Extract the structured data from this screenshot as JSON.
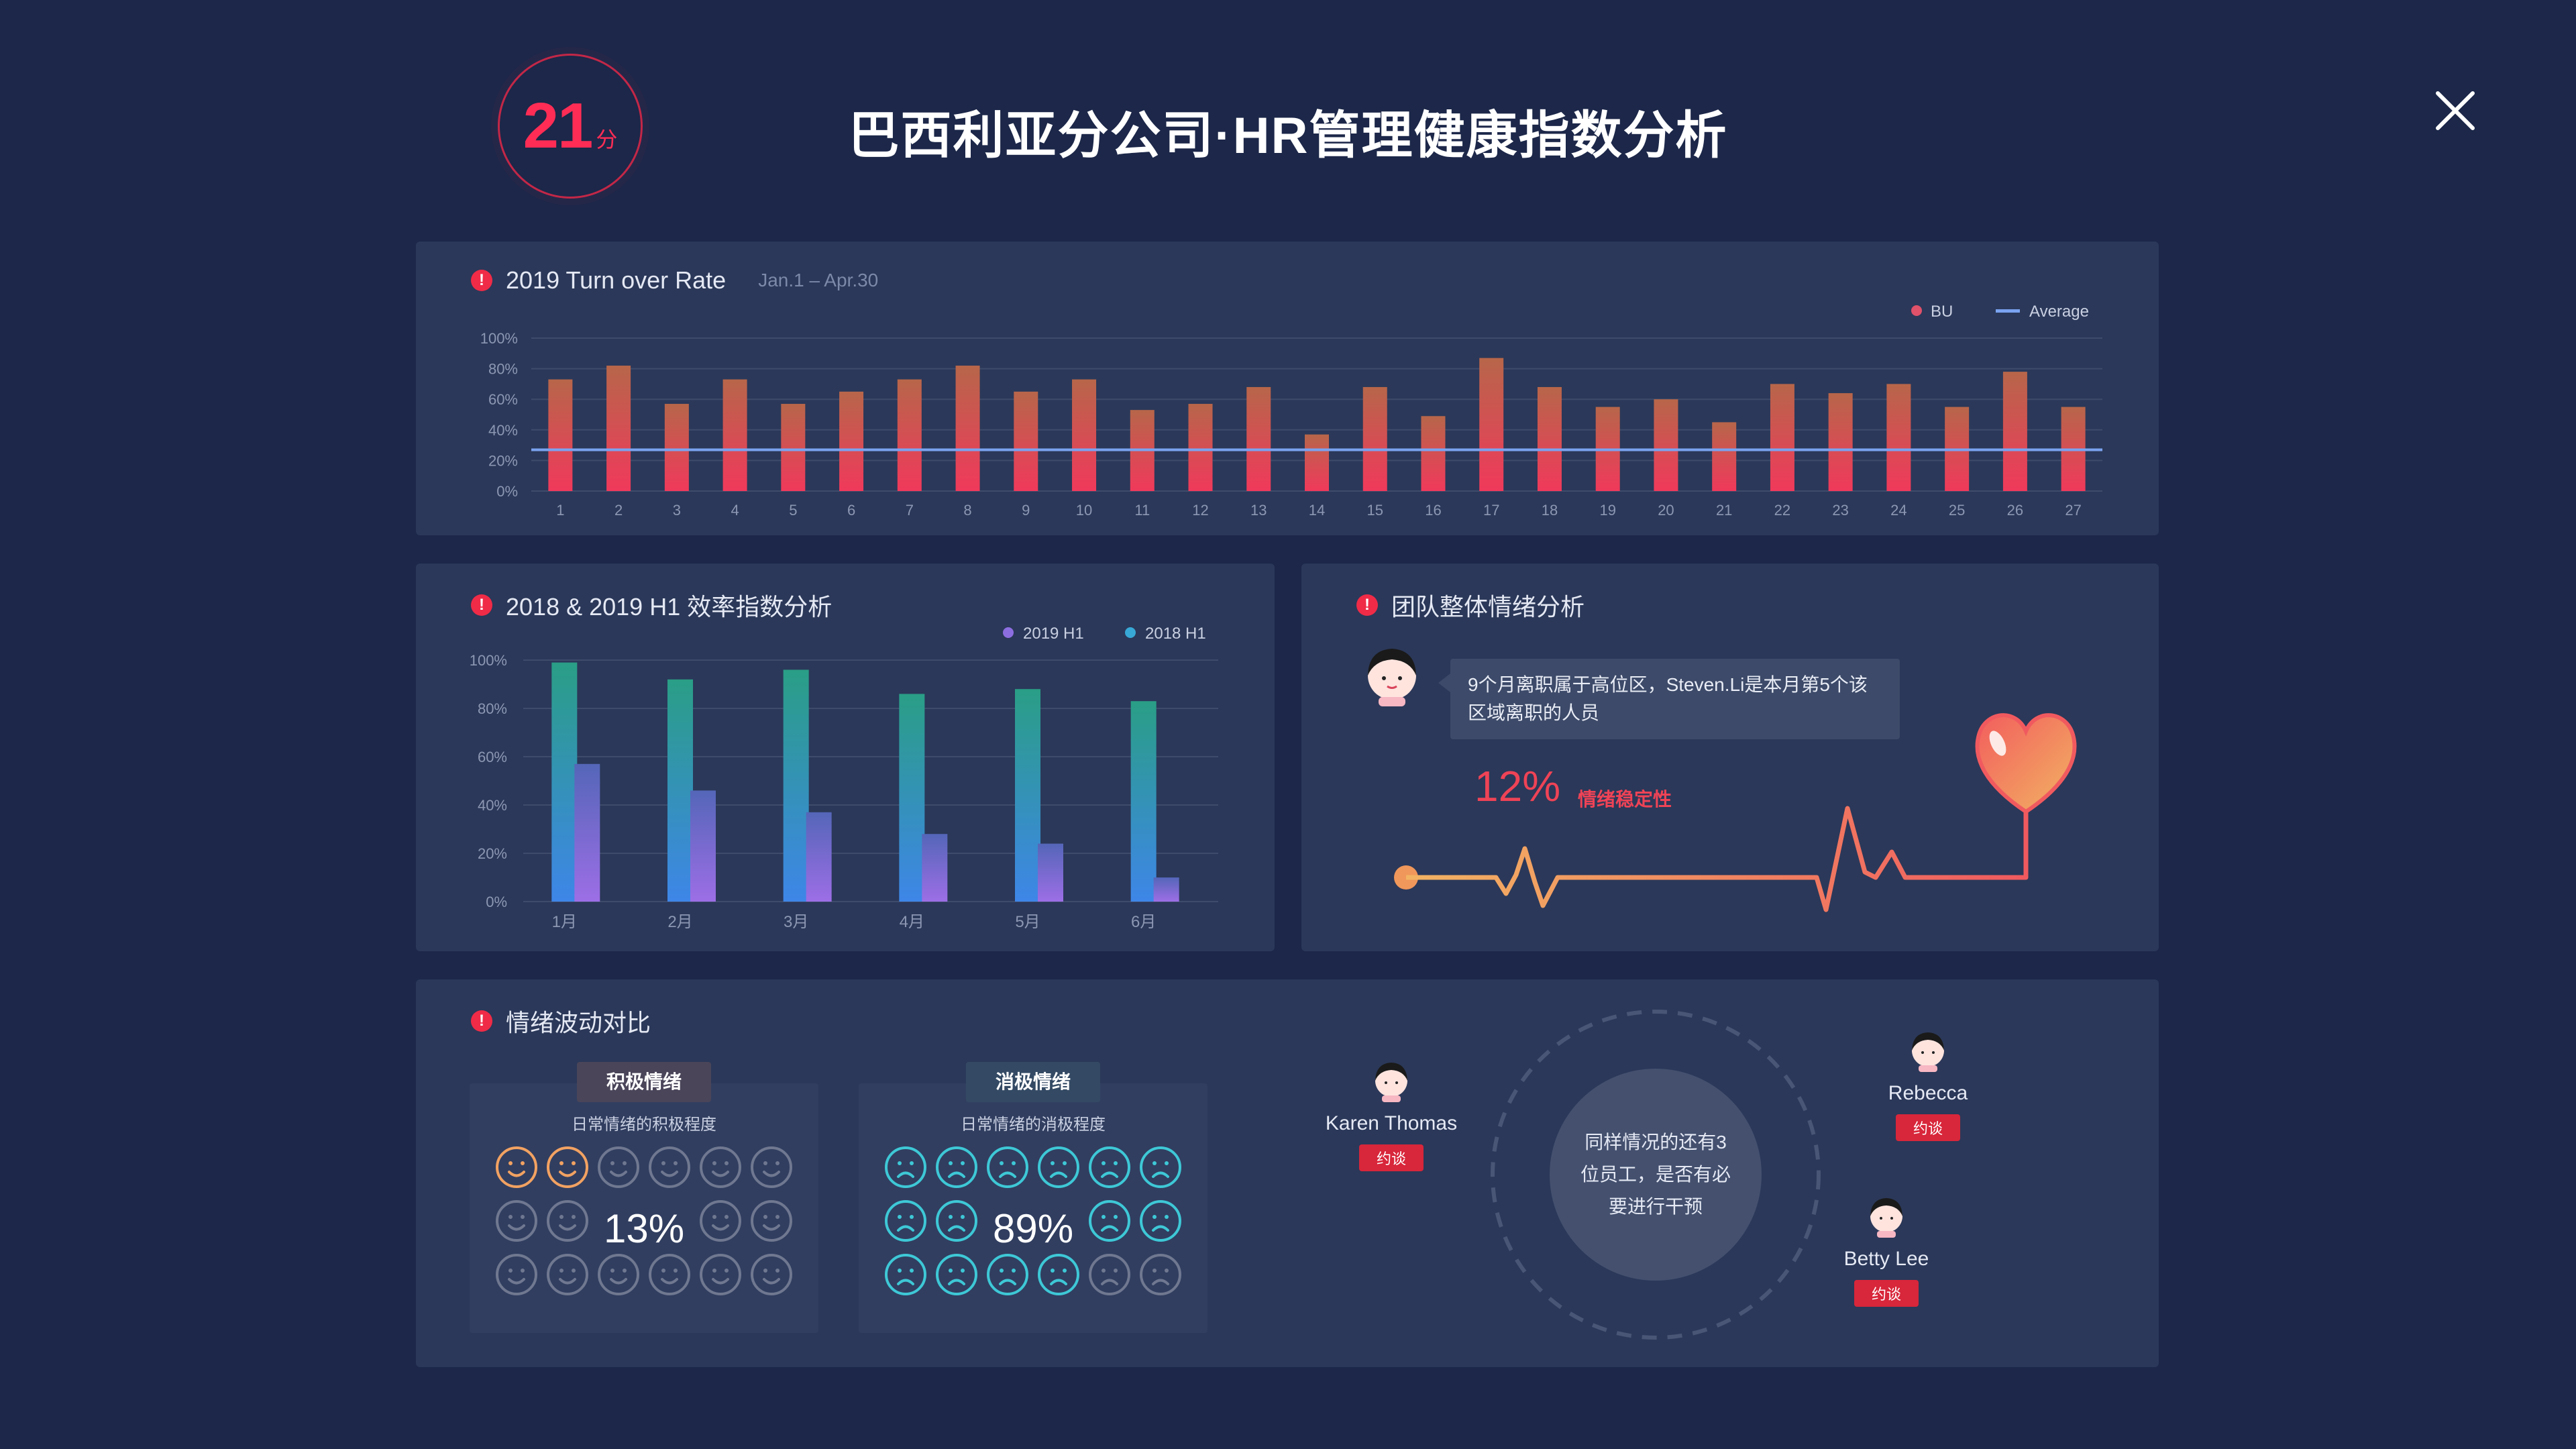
{
  "header": {
    "score": "21",
    "score_unit": "分",
    "title": "巴西利亚分公司·HR管理健康指数分析"
  },
  "colors": {
    "background": "#1c2749",
    "panel": "#2b3859",
    "accent_red": "#ff2d55",
    "bar_top": "#b7664a",
    "bar_bottom": "#f0395b",
    "average_line": "#7aa3f0",
    "series_2019": "#8d6ee0",
    "series_2018": "#38a8d6"
  },
  "turnover": {
    "title": "2019 Turn over Rate",
    "date_range": "Jan.1 – Apr.30",
    "legend_bu": "BU",
    "legend_avg": "Average"
  },
  "efficiency": {
    "title": "2018 & 2019 H1 效率指数分析"
  },
  "team_emotion": {
    "title": "团队整体情绪分析",
    "message": "9个月离职属于高位区，Steven.Li是本月第5个该区域离职的人员",
    "stability_value": "12%",
    "stability_label": "情绪稳定性"
  },
  "emotion_compare": {
    "title": "情绪波动对比",
    "positive": {
      "tag": "积极情绪",
      "desc": "日常情绪的积极程度",
      "value": "13%",
      "count": 2,
      "total": 16
    },
    "negative": {
      "tag": "消极情绪",
      "desc": "日常情绪的消极程度",
      "value": "89%",
      "count": 14,
      "total": 16
    },
    "center_text": "同样情况的还有3 位员工，是否有必要进行干预",
    "people": [
      {
        "name": "Karen Thomas",
        "action": "约谈"
      },
      {
        "name": "Rebecca",
        "action": "约谈"
      },
      {
        "name": "Betty Lee",
        "action": "约谈"
      }
    ]
  },
  "icons": [
    "close-icon",
    "alert-icon",
    "smile-icon",
    "sad-icon",
    "heart-icon",
    "avatar-icon"
  ],
  "chart_data": [
    {
      "type": "bar",
      "title": "2019 Turn over Rate",
      "categories": [
        "1",
        "2",
        "3",
        "4",
        "5",
        "6",
        "7",
        "8",
        "9",
        "10",
        "11",
        "12",
        "13",
        "14",
        "15",
        "16",
        "17",
        "18",
        "19",
        "20",
        "21",
        "22",
        "23",
        "24",
        "25",
        "26",
        "27"
      ],
      "series": [
        {
          "name": "BU",
          "values": [
            73,
            82,
            57,
            73,
            57,
            65,
            73,
            82,
            65,
            73,
            53,
            57,
            68,
            37,
            68,
            49,
            87,
            68,
            55,
            60,
            45,
            70,
            64,
            70,
            55,
            78,
            55
          ]
        },
        {
          "name": "Average",
          "type": "line",
          "value": 27
        }
      ],
      "ylim": [
        0,
        100
      ],
      "yticks": [
        "0%",
        "20%",
        "40%",
        "60%",
        "80%",
        "100%"
      ],
      "grid": true,
      "legend": "top-right"
    },
    {
      "type": "bar",
      "title": "2018 & 2019 H1 效率指数分析",
      "categories": [
        "1月",
        "2月",
        "3月",
        "4月",
        "5月",
        "6月"
      ],
      "series": [
        {
          "name": "2018 H1",
          "values": [
            99,
            92,
            96,
            86,
            88,
            83
          ]
        },
        {
          "name": "2019 H1",
          "values": [
            57,
            46,
            37,
            28,
            24,
            10
          ]
        }
      ],
      "ylim": [
        0,
        100
      ],
      "yticks": [
        "0%",
        "20%",
        "40%",
        "60%",
        "80%",
        "100%"
      ],
      "grid": true,
      "legend": "top-right"
    }
  ]
}
